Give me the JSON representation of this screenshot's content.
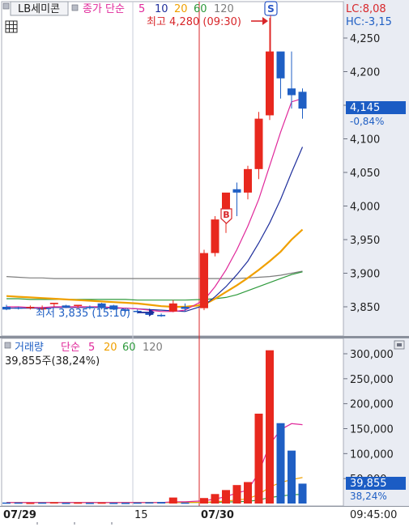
{
  "price_panel": {
    "legend_name": "LB세미콘",
    "legend_ma_type": "종가 단순",
    "legend_ma_periods": [
      "5",
      "10",
      "20",
      "60",
      "120"
    ],
    "right_info": [
      "LC:8,08",
      "HC:-3,15"
    ],
    "high_label": "최고 4,280 (09:30)",
    "low_label": "최저 3,835 (15:10)",
    "current_price": "4,145",
    "current_change": "-0,84%",
    "badge_s": "S",
    "badge_b": "B"
  },
  "volume_panel": {
    "legend_name": "거래량",
    "legend_ma_type": "단순",
    "legend_ma_periods": [
      "5",
      "20",
      "60",
      "120"
    ],
    "volume_text": "39,855주(38,24%)",
    "current_volume": "39,855",
    "current_pct": "38,24%"
  },
  "x_axis": {
    "labels": [
      "07/29",
      "15",
      "07/30"
    ],
    "time": "09:45:00"
  },
  "colors": {
    "up": "#e8281e",
    "down": "#1f5fc4",
    "ma5": "#e0289a",
    "ma10": "#1f2f9c",
    "ma20": "#f0a000",
    "ma60": "#2e9a3c",
    "ma120": "#7d7d7d",
    "axis_text": "#1e1e1e",
    "right_bg": "#e9ecf3",
    "marker": "#d8262a"
  },
  "chart_data": [
    {
      "type": "candlestick",
      "y_unit": "KRW",
      "ylim": [
        3800,
        4290
      ],
      "yticks": [
        3850,
        3900,
        3950,
        4000,
        4050,
        4100,
        4150,
        4200,
        4250
      ],
      "x": [
        "07/29 1",
        "07/29 2",
        "07/29 3",
        "07/29 4",
        "07/29 5",
        "07/29 6",
        "07/29 7",
        "07/29 8",
        "07/29 9",
        "07/29 10",
        "07/29 11",
        "07/29 12",
        "07/29 13",
        "07/29 14",
        "07/29 15",
        "07/29 16",
        "07/30 1",
        "07/30 2",
        "07/30 3",
        "07/30 4",
        "07/30 5",
        "07/30 6",
        "07/30 7",
        "07/30 8",
        "07/30 9"
      ],
      "ohlc": [
        [
          3850,
          3853,
          3845,
          3846
        ],
        [
          3849,
          3850,
          3846,
          3848
        ],
        [
          3848,
          3852,
          3846,
          3850
        ],
        [
          3848,
          3852,
          3845,
          3848
        ],
        [
          3854,
          3855,
          3850,
          3856
        ],
        [
          3852,
          3853,
          3848,
          3849
        ],
        [
          3852,
          3853,
          3848,
          3853
        ],
        [
          3850,
          3852,
          3846,
          3848
        ],
        [
          3855,
          3856,
          3846,
          3848
        ],
        [
          3852,
          3853,
          3845,
          3846
        ],
        [
          3846,
          3848,
          3842,
          3844
        ],
        [
          3844,
          3846,
          3840,
          3843
        ],
        [
          3842,
          3843,
          3836,
          3838
        ],
        [
          3838,
          3840,
          3835,
          3836
        ],
        [
          3843,
          3860,
          3842,
          3855
        ],
        [
          3850,
          3855,
          3843,
          3847
        ],
        [
          3848,
          3935,
          3845,
          3930
        ],
        [
          3930,
          3985,
          3925,
          3980
        ],
        [
          3985,
          3998,
          3960,
          4020
        ],
        [
          4025,
          4035,
          3985,
          4020
        ],
        [
          4020,
          4060,
          4010,
          4055
        ],
        [
          4055,
          4140,
          4040,
          4130
        ],
        [
          4135,
          4280,
          4128,
          4230
        ],
        [
          4230,
          4225,
          4160,
          4190
        ],
        [
          4175,
          4230,
          4145,
          4165
        ],
        [
          4170,
          4175,
          4130,
          4145
        ]
      ],
      "moving_averages": {
        "5": [
          3850,
          3850,
          3849,
          3849,
          3850,
          3850,
          3850,
          3850,
          3850,
          3849,
          3848,
          3847,
          3845,
          3843,
          3843,
          3845,
          3860,
          3880,
          3905,
          3935,
          3970,
          4010,
          4060,
          4110,
          4155,
          4160
        ],
        "10": [
          3848,
          3848,
          3848,
          3848,
          3849,
          3849,
          3849,
          3849,
          3849,
          3848,
          3848,
          3847,
          3846,
          3845,
          3844,
          3843,
          3852,
          3865,
          3880,
          3898,
          3918,
          3945,
          3975,
          4010,
          4050,
          4088
        ],
        "20": [
          3866,
          3865,
          3864,
          3863,
          3862,
          3861,
          3860,
          3859,
          3858,
          3857,
          3856,
          3855,
          3853,
          3851,
          3850,
          3850,
          3853,
          3862,
          3872,
          3882,
          3893,
          3905,
          3918,
          3932,
          3950,
          3965
        ],
        "60": [
          3862,
          3862,
          3861,
          3861,
          3861,
          3861,
          3861,
          3861,
          3861,
          3861,
          3861,
          3860,
          3860,
          3860,
          3860,
          3860,
          3861,
          3862,
          3864,
          3868,
          3874,
          3880,
          3886,
          3892,
          3898,
          3902
        ],
        "120": [
          3895,
          3894,
          3893,
          3893,
          3892,
          3892,
          3892,
          3892,
          3892,
          3892,
          3892,
          3892,
          3892,
          3892,
          3892,
          3892,
          3892,
          3892,
          3892,
          3892,
          3893,
          3894,
          3895,
          3897,
          3900,
          3903
        ]
      }
    },
    {
      "type": "bar",
      "y_unit": "shares",
      "ylim": [
        0,
        315000
      ],
      "yticks": [
        50000,
        100000,
        150000,
        200000,
        250000,
        300000
      ],
      "values": [
        2000,
        2000,
        1500,
        2000,
        2500,
        1500,
        2000,
        1500,
        2000,
        1500,
        1500,
        2000,
        2500,
        3000,
        12000,
        2000,
        11000,
        19000,
        27000,
        37000,
        43000,
        180000,
        307000,
        161000,
        106000,
        39855
      ],
      "up": [
        false,
        false,
        true,
        false,
        true,
        false,
        true,
        false,
        true,
        false,
        false,
        false,
        false,
        false,
        true,
        false,
        true,
        true,
        true,
        true,
        true,
        true,
        true,
        false,
        false,
        false
      ],
      "moving_averages": {
        "5": [
          2000,
          2000,
          2000,
          2000,
          2000,
          2000,
          2000,
          2000,
          2000,
          2000,
          2000,
          2000,
          2000,
          2000,
          3500,
          3500,
          5500,
          9000,
          14000,
          21000,
          27000,
          62000,
          118000,
          148000,
          160000,
          158000
        ],
        "20": [
          2000,
          2000,
          2000,
          2000,
          2000,
          2000,
          2000,
          2000,
          2000,
          2000,
          2000,
          2000,
          2000,
          2000,
          2100,
          2200,
          2600,
          3500,
          5000,
          7000,
          9500,
          18000,
          33000,
          42000,
          48000,
          52000
        ],
        "60": [
          2000,
          2000,
          2000,
          2000,
          2000,
          2000,
          2000,
          2000,
          2000,
          2000,
          2000,
          2000,
          2000,
          2000,
          2000,
          2000,
          2200,
          2500,
          3000,
          3600,
          4300,
          7000,
          12000,
          15000,
          17500,
          18500
        ]
      }
    }
  ]
}
